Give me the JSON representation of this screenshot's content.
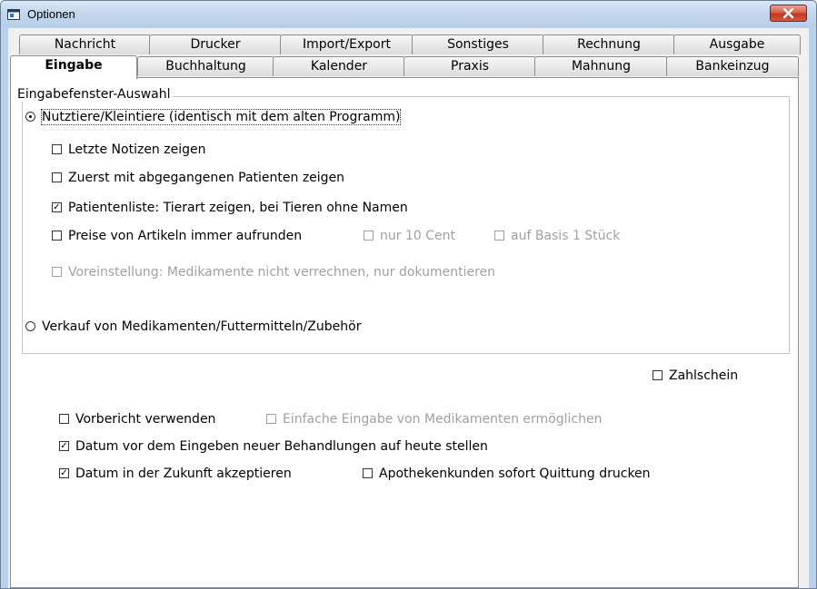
{
  "window": {
    "title": "Optionen"
  },
  "tabs_row1": [
    "Nachricht",
    "Drucker",
    "Import/Export",
    "Sonstiges",
    "Rechnung",
    "Ausgabe"
  ],
  "tabs_row2": [
    "Eingabe",
    "Buchhaltung",
    "Kalender",
    "Praxis",
    "Mahnung",
    "Bankeinzug"
  ],
  "active_tab": "Eingabe",
  "group": {
    "title": "Eingabefenster-Auswahl",
    "radio_small_animals": {
      "label": "Nutztiere/Kleintiere (identisch mit dem alten Programm)",
      "selected": true
    },
    "cb_last_notes": {
      "label": "Letzte Notizen zeigen",
      "checked": false
    },
    "cb_departed_patients": {
      "label": "Zuerst mit abgegangenen Patienten zeigen",
      "checked": false
    },
    "cb_patient_list": {
      "label": "Patientenliste: Tierart zeigen, bei Tieren ohne Namen",
      "checked": true
    },
    "cb_round_prices": {
      "label": "Preise von Artikeln immer aufrunden",
      "checked": false
    },
    "cb_ten_cent": {
      "label": "nur 10 Cent",
      "checked": false,
      "enabled": false
    },
    "cb_one_piece": {
      "label": "auf Basis 1 Stück",
      "checked": false,
      "enabled": false
    },
    "cb_preset_meds": {
      "label": "Voreinstellung: Medikamente nicht verrechnen, nur dokumentieren",
      "checked": false,
      "enabled": false
    },
    "radio_sale": {
      "label": "Verkauf von Medikamenten/Futtermitteln/Zubehör",
      "selected": false
    }
  },
  "cb_payslip": {
    "label": "Zahlschein",
    "checked": false
  },
  "cb_preliminary_report": {
    "label": "Vorbericht verwenden",
    "checked": false
  },
  "cb_simple_meds": {
    "label": "Einfache Eingabe von Medikamenten ermöglichen",
    "checked": false,
    "enabled": false
  },
  "cb_date_today": {
    "label": "Datum vor dem Eingeben neuer Behandlungen auf heute stellen",
    "checked": true
  },
  "cb_future_date": {
    "label": "Datum in der Zukunft akzeptieren",
    "checked": true
  },
  "cb_pharmacy_receipt": {
    "label": "Apothekenkunden sofort Quittung drucken",
    "checked": false
  }
}
